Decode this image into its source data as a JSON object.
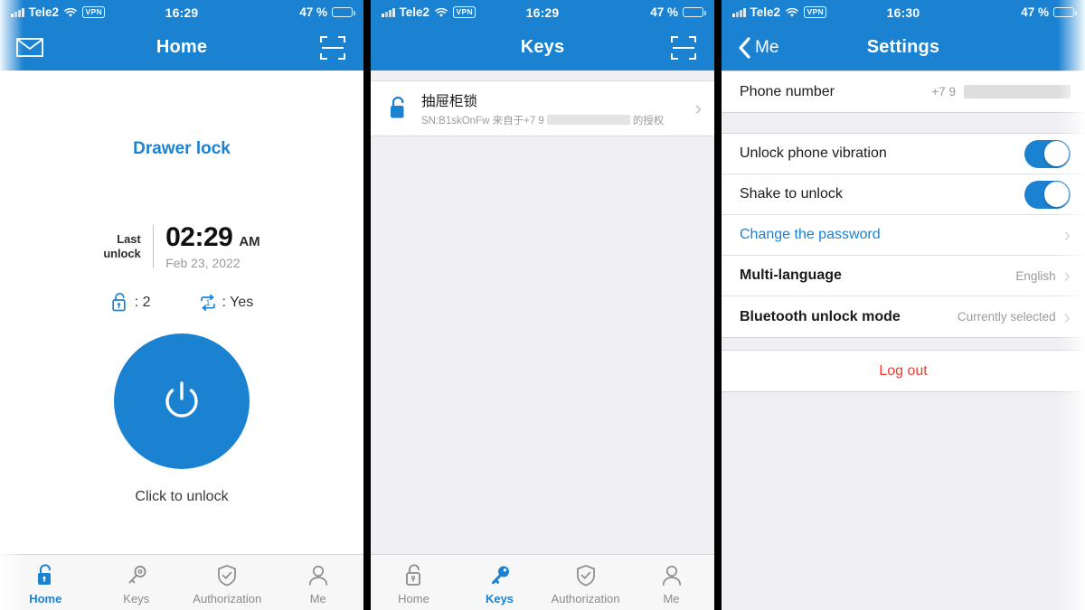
{
  "statusbar": {
    "carrier": "Tele2",
    "vpn": "VPN",
    "time_1": "16:29",
    "time_2": "16:29",
    "time_3": "16:30",
    "battery": "47 %",
    "battery_level": 47,
    "battery_color": "#f6c915"
  },
  "theme": {
    "accent": "#1b82d2",
    "danger": "#f33b30",
    "muted": "#9b9b9b",
    "group_bg": "#efeff4"
  },
  "panel_home": {
    "nav": {
      "title": "Home",
      "left_icon": "mail-icon",
      "right_icon": "scan-icon"
    },
    "lock_name": "Drawer lock",
    "last_unlock": {
      "label_line1": "Last",
      "label_line2": "unlock",
      "time": "02:29",
      "ampm": "AM",
      "date": "Feb 23, 2022"
    },
    "stats": [
      {
        "icon": "unlock-count-icon",
        "value": ": 2"
      },
      {
        "icon": "repeat-one-icon",
        "value": ": Yes"
      }
    ],
    "unlock_button": {
      "icon": "power-icon",
      "caption": "Click to unlock"
    },
    "tabs": [
      {
        "label": "Home",
        "icon": "lock-open-filled-icon",
        "active": true
      },
      {
        "label": "Keys",
        "icon": "key-outline-icon",
        "active": false
      },
      {
        "label": "Authorization",
        "icon": "shield-check-icon",
        "active": false
      },
      {
        "label": "Me",
        "icon": "person-icon",
        "active": false
      }
    ]
  },
  "panel_keys": {
    "nav": {
      "title": "Keys",
      "right_icon": "scan-icon"
    },
    "key_item": {
      "icon": "lock-open-filled-icon",
      "title": "抽屉柜锁",
      "sub_prefix": "SN:B1skOnFw 来自于+7 9",
      "sub_suffix": "的授权",
      "chevron": "›"
    },
    "tabs": [
      {
        "label": "Home",
        "icon": "lock-open-outline-icon",
        "active": false
      },
      {
        "label": "Keys",
        "icon": "key-filled-icon",
        "active": true
      },
      {
        "label": "Authorization",
        "icon": "shield-check-icon",
        "active": false
      },
      {
        "label": "Me",
        "icon": "person-icon",
        "active": false
      }
    ]
  },
  "panel_settings": {
    "nav": {
      "title": "Settings",
      "back_label": "Me",
      "back_icon": "chevron-left-icon"
    },
    "rows": [
      {
        "label": "Phone number",
        "value": "+7 9",
        "type": "redacted",
        "chevron": false
      },
      {
        "label": "Unlock phone vibration",
        "type": "toggle",
        "on": true
      },
      {
        "label": "Shake to unlock",
        "type": "toggle",
        "on": true
      },
      {
        "label": "Change the password",
        "type": "link",
        "chevron": "›"
      },
      {
        "label": "Multi-language",
        "value": "English",
        "type": "value",
        "chevron": "›"
      },
      {
        "label": "Bluetooth unlock mode",
        "value": "Currently selected",
        "type": "value",
        "chevron": "›"
      }
    ],
    "logout": "Log out"
  }
}
